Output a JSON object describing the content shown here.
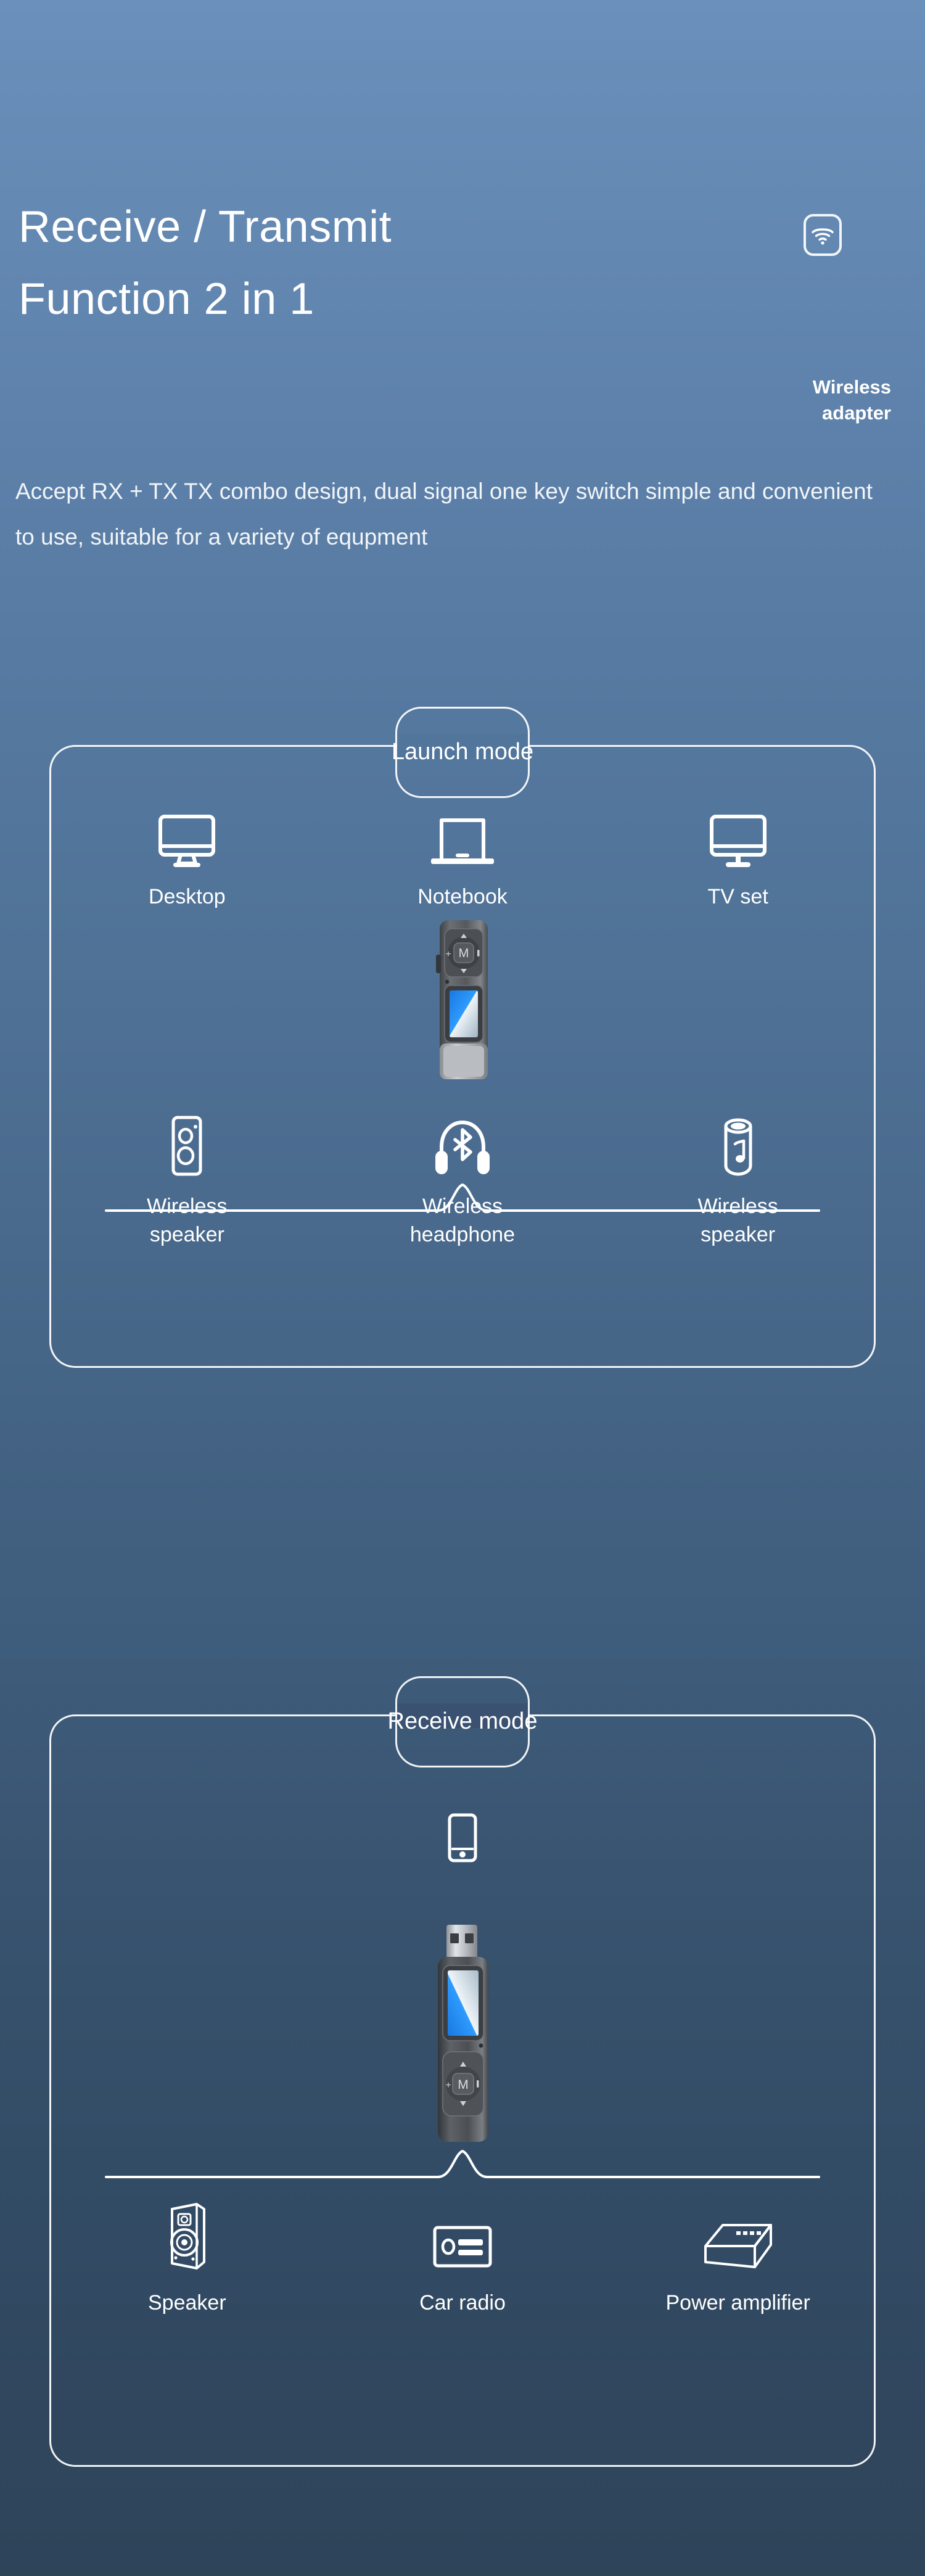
{
  "header": {
    "title_line1": "Receive / Transmit",
    "title_line2": "Function 2 in 1",
    "brand_line1": "Wireless",
    "brand_line2": "adapter",
    "description": "Accept RX + TX TX combo design, dual signal one key switch simple and convenient to use, suitable for a variety of equpment",
    "wifi_icon": "wifi-icon"
  },
  "colors": {
    "background_top": "#6a90bb",
    "background_bottom": "#2e4459",
    "outline": "#ffffff",
    "device_body": "#4a4e52",
    "device_screen": "#1e90ff"
  },
  "panels": [
    {
      "id": "launch",
      "tab_label": "Launch mode",
      "sources": [
        {
          "label": "Desktop",
          "icon": "desktop-monitor-icon"
        },
        {
          "label": "Notebook",
          "icon": "laptop-icon"
        },
        {
          "label": "TV set",
          "icon": "tv-icon"
        }
      ],
      "device": "usb-bluetooth-adapter-front",
      "targets": [
        {
          "label": "Wireless\nspeaker",
          "icon": "box-speaker-icon"
        },
        {
          "label": "Wireless\nheadphone",
          "icon": "bluetooth-headphone-icon"
        },
        {
          "label": "Wireless\nspeaker",
          "icon": "cylinder-speaker-icon"
        }
      ]
    },
    {
      "id": "receive",
      "tab_label": "Receive mode",
      "sources": [
        {
          "label": "",
          "icon": "smartphone-icon"
        }
      ],
      "device": "usb-bluetooth-adapter-plug",
      "targets": [
        {
          "label": "Speaker",
          "icon": "tower-speaker-icon"
        },
        {
          "label": "Car radio",
          "icon": "car-radio-icon"
        },
        {
          "label": "Power amplifier",
          "icon": "amplifier-box-icon"
        }
      ]
    }
  ]
}
